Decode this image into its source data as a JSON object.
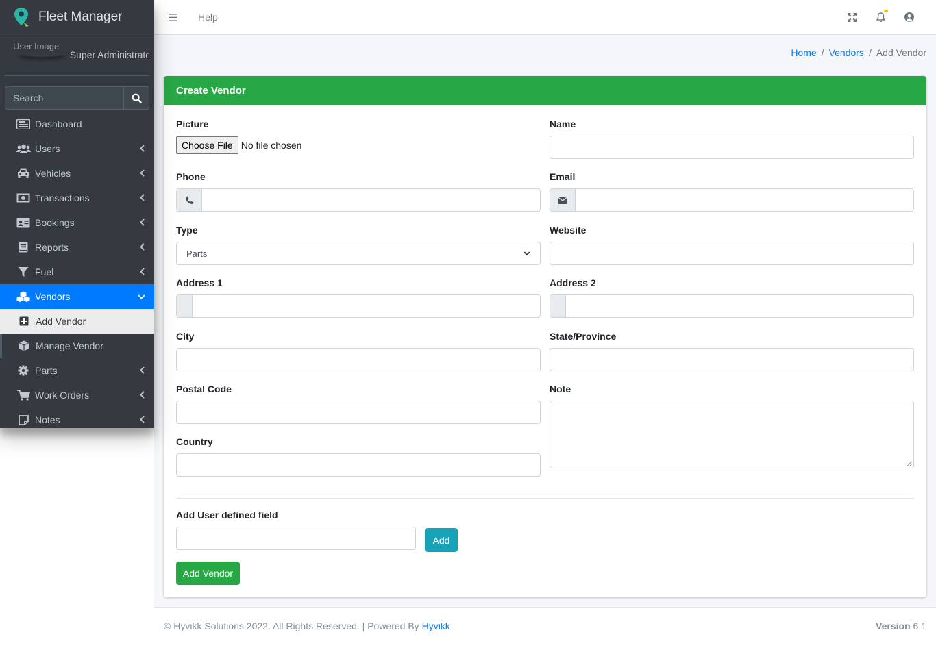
{
  "brand": {
    "name": "Fleet Manager",
    "logo_icon": "map-marker-logo"
  },
  "user": {
    "image_alt": "User Image",
    "name": "Super Administrator"
  },
  "search": {
    "placeholder": "Search"
  },
  "sidebar": {
    "items": [
      {
        "label": "Dashboard",
        "icon": "dashboard-icon"
      },
      {
        "label": "Users",
        "icon": "users-icon"
      },
      {
        "label": "Vehicles",
        "icon": "car-icon"
      },
      {
        "label": "Transactions",
        "icon": "money-icon"
      },
      {
        "label": "Bookings",
        "icon": "address-card-icon"
      },
      {
        "label": "Reports",
        "icon": "book-icon"
      },
      {
        "label": "Fuel",
        "icon": "filter-icon"
      },
      {
        "label": "Vendors",
        "icon": "cubes-icon"
      },
      {
        "label": "Parts",
        "icon": "gear-icon"
      },
      {
        "label": "Work Orders",
        "icon": "cart-icon"
      },
      {
        "label": "Notes",
        "icon": "sticky-note-icon"
      }
    ],
    "vendors_sub": [
      {
        "label": "Add Vendor",
        "icon": "plus-square-icon"
      },
      {
        "label": "Manage Vendor",
        "icon": "cube-icon"
      }
    ]
  },
  "topnav": {
    "help": "Help"
  },
  "breadcrumb": {
    "home": "Home",
    "vendors": "Vendors",
    "current": "Add Vendor"
  },
  "form": {
    "title": "Create Vendor",
    "picture_label": "Picture",
    "file_button": "Choose File",
    "file_status": "No file chosen",
    "name_label": "Name",
    "phone_label": "Phone",
    "email_label": "Email",
    "type_label": "Type",
    "type_value": "Parts",
    "website_label": "Website",
    "address1_label": "Address 1",
    "address2_label": "Address 2",
    "city_label": "City",
    "state_label": "State/Province",
    "postal_label": "Postal Code",
    "note_label": "Note",
    "country_label": "Country",
    "udf_label": "Add User defined field",
    "add_button": "Add",
    "submit_button": "Add Vendor"
  },
  "footer": {
    "copyright": "© Hyvikk Solutions 2022. All Rights Reserved. | Powered By ",
    "powered_link": "Hyvikk",
    "version_label": "Version",
    "version_value": "6.1"
  },
  "colors": {
    "header_green": "#28a745",
    "active_blue": "#007bff",
    "add_teal": "#17a2b8",
    "sidebar_dark": "#343a40"
  }
}
